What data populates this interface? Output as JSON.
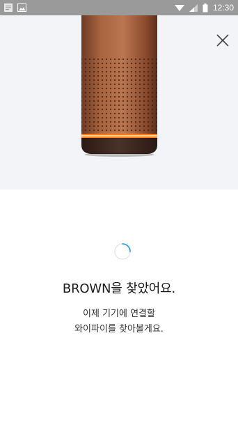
{
  "status_bar": {
    "time": "12:30",
    "left_icons": [
      "notification-icon",
      "image-icon"
    ],
    "right_icons": [
      "wifi-icon",
      "signal-icon",
      "battery-icon"
    ]
  },
  "hero": {
    "close_icon": "close-icon",
    "device_image": "speaker-device",
    "accent_color": "#ff7a1a"
  },
  "main": {
    "title": "BROWN을 찾았어요.",
    "description_lines": [
      "이제 기기에 연결할",
      "와이파이를 찾아볼게요."
    ]
  }
}
